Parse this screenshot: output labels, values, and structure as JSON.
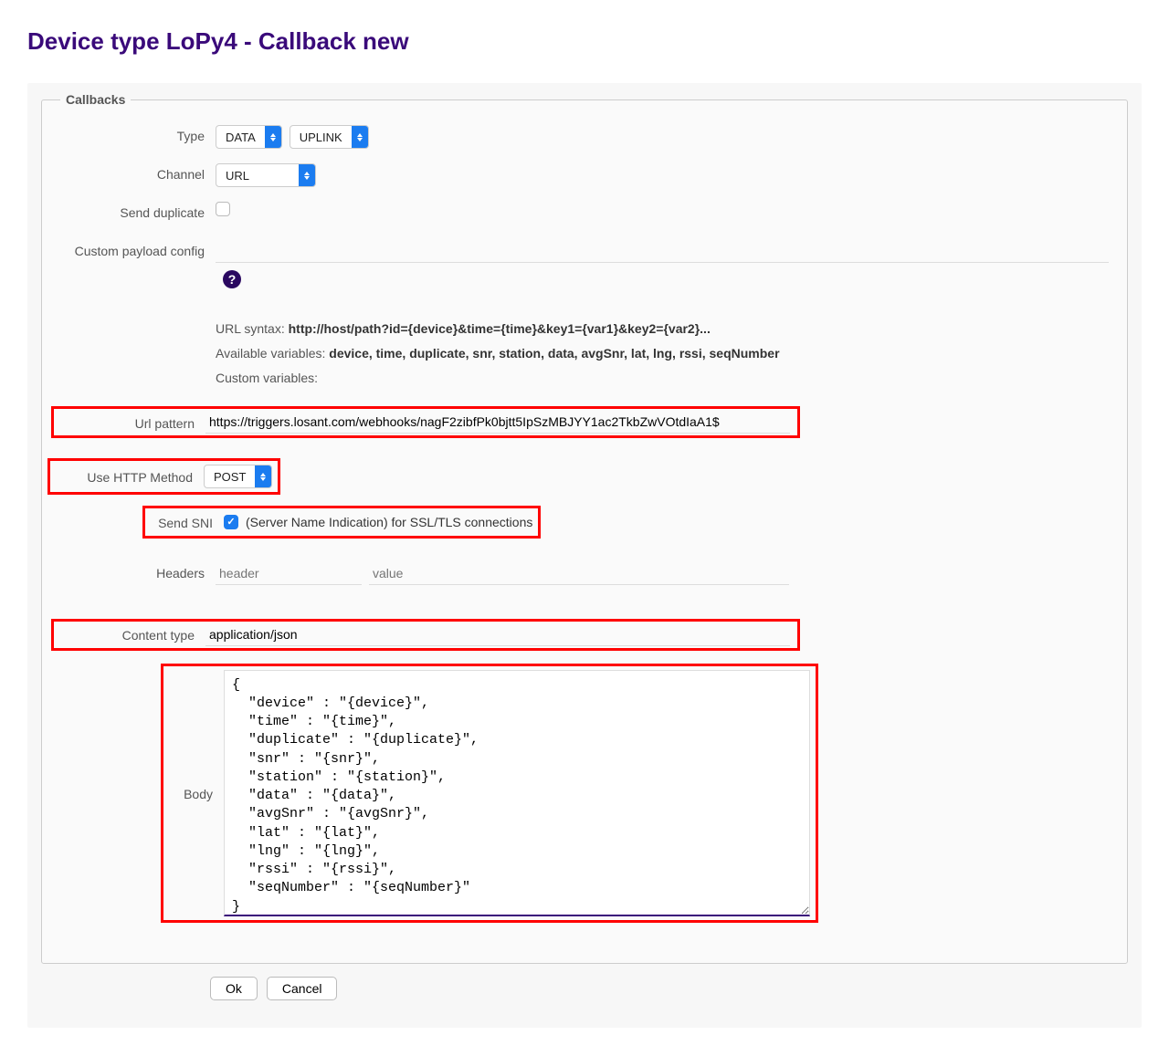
{
  "page_title": "Device type LoPy4 - Callback new",
  "fieldset_legend": "Callbacks",
  "labels": {
    "type": "Type",
    "channel": "Channel",
    "send_duplicate": "Send duplicate",
    "custom_payload": "Custom payload config",
    "url_pattern": "Url pattern",
    "http_method": "Use HTTP Method",
    "send_sni": "Send SNI",
    "headers": "Headers",
    "content_type": "Content type",
    "body": "Body"
  },
  "selects": {
    "type1": "DATA",
    "type2": "UPLINK",
    "channel": "URL",
    "http_method": "POST"
  },
  "checkboxes": {
    "send_duplicate": false,
    "send_sni": true
  },
  "help": {
    "url_syntax_prefix": "URL syntax: ",
    "url_syntax_bold": "http://host/path?id={device}&time={time}&key1={var1}&key2={var2}...",
    "avail_prefix": "Available variables: ",
    "avail_bold": "device, time, duplicate, snr, station, data, avgSnr, lat, lng, rssi, seqNumber",
    "custom_vars": "Custom variables:"
  },
  "inputs": {
    "custom_payload": "",
    "url_pattern": "https://triggers.losant.com/webhooks/nagF2zibfPk0bjtt5IpSzMBJYY1ac2TkbZwVOtdIaA1$",
    "header_key_placeholder": "header",
    "header_val_placeholder": "value",
    "content_type": "application/json"
  },
  "sni_desc": "(Server Name Indication) for SSL/TLS connections",
  "body_text": "{\n  \"device\" : \"{device}\",\n  \"time\" : \"{time}\",\n  \"duplicate\" : \"{duplicate}\",\n  \"snr\" : \"{snr}\",\n  \"station\" : \"{station}\",\n  \"data\" : \"{data}\",\n  \"avgSnr\" : \"{avgSnr}\",\n  \"lat\" : \"{lat}\",\n  \"lng\" : \"{lng}\",\n  \"rssi\" : \"{rssi}\",\n  \"seqNumber\" : \"{seqNumber}\"\n}",
  "buttons": {
    "ok": "Ok",
    "cancel": "Cancel"
  },
  "help_icon": "?"
}
